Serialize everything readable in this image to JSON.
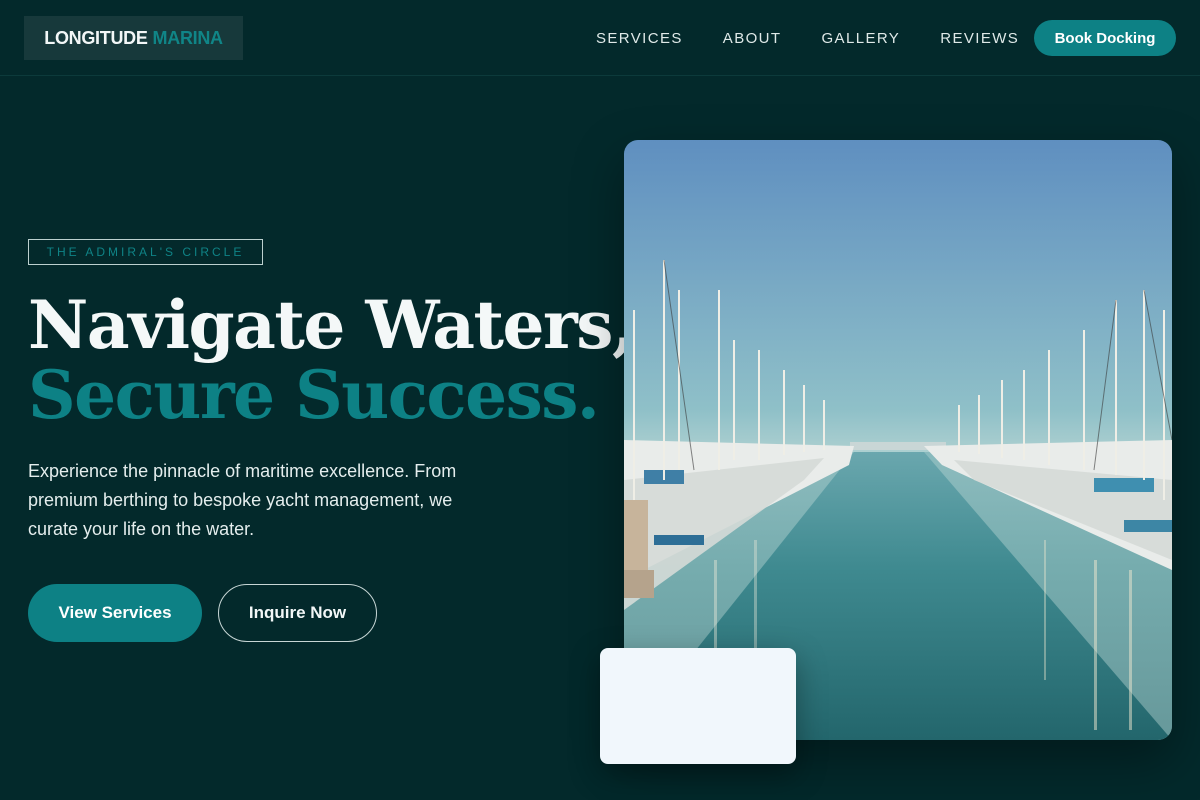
{
  "brand": {
    "name_part1": "LONGITUDE",
    "name_part2": "MARINA"
  },
  "nav": {
    "items": [
      {
        "label": "SERVICES"
      },
      {
        "label": "ABOUT"
      },
      {
        "label": "GALLERY"
      },
      {
        "label": "REVIEWS"
      }
    ],
    "cta_label": "Book Docking"
  },
  "hero": {
    "eyebrow": "THE ADMIRAL'S CIRCLE",
    "headline_line1": "Navigate Waters,",
    "headline_line2": "Secure Success.",
    "description": "Experience the pinnacle of maritime excellence. From premium berthing to bespoke yacht management, we curate your life on the water.",
    "primary_button": "View Services",
    "secondary_button": "Inquire Now",
    "image_subject": "marina-photo"
  },
  "colors": {
    "background": "#03292b",
    "accent": "#0d8185",
    "text": "#f4f8f8",
    "card": "#f1f7fc"
  }
}
